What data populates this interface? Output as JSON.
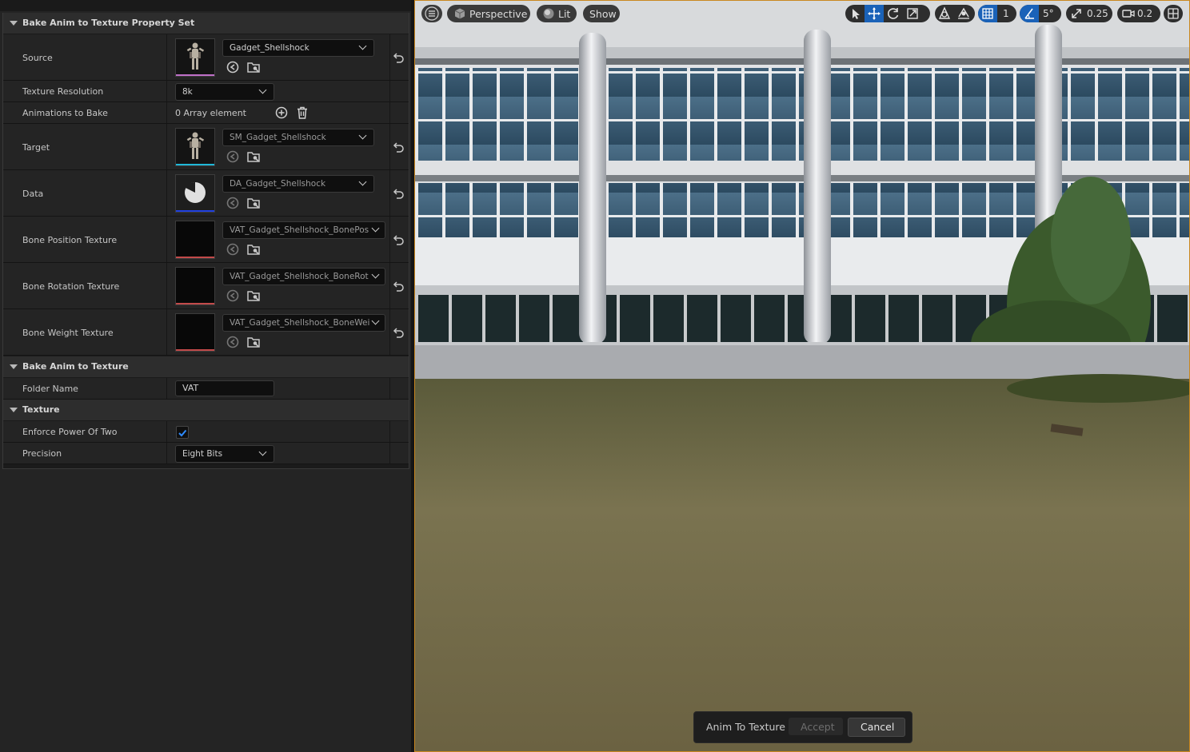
{
  "details": {
    "category1": "Bake Anim to Texture Property Set",
    "source": {
      "label": "Source",
      "value": "Gadget_Shellshock",
      "bar_color": "#c070c8"
    },
    "texture_resolution": {
      "label": "Texture Resolution",
      "value": "8k"
    },
    "animations": {
      "label": "Animations to Bake",
      "value": "0 Array element"
    },
    "target": {
      "label": "Target",
      "value": "SM_Gadget_Shellshock",
      "bar_color": "#1fb8d8"
    },
    "data": {
      "label": "Data",
      "value": "DA_Gadget_Shellshock",
      "bar_color": "#2040e0"
    },
    "bone_position": {
      "label": "Bone Position Texture",
      "value": "VAT_Gadget_Shellshock_BonePos",
      "bar_color": "#c24a4a"
    },
    "bone_rotation": {
      "label": "Bone Rotation Texture",
      "value": "VAT_Gadget_Shellshock_BoneRot",
      "bar_color": "#c24a4a"
    },
    "bone_weight": {
      "label": "Bone Weight Texture",
      "value": "VAT_Gadget_Shellshock_BoneWei",
      "bar_color": "#c24a4a"
    },
    "category2": "Bake Anim to Texture",
    "folder_name": {
      "label": "Folder Name",
      "value": "VAT"
    },
    "category3": "Texture",
    "enforce_pow2": {
      "label": "Enforce Power Of Two",
      "checked": true
    },
    "precision": {
      "label": "Precision",
      "value": "Eight Bits"
    }
  },
  "viewport": {
    "toolbar": {
      "perspective": "Perspective",
      "lit": "Lit",
      "show": "Show",
      "grid_snap": "1",
      "angle_snap": "5°",
      "scale_snap": "0.25",
      "camera_speed": "0.2"
    },
    "icons": [
      "menu-icon",
      "cube-icon",
      "lit-sphere-icon",
      "select-arrow-icon",
      "translate-icon",
      "rotate-icon",
      "scale-icon",
      "world-local-icon",
      "surface-snap-icon",
      "grid-icon",
      "angle-icon",
      "scale-snap-icon",
      "camera-icon",
      "layout-icon"
    ],
    "popup": {
      "title": "Anim To Texture",
      "accept": "Accept",
      "cancel": "Cancel"
    },
    "colors": {
      "accent": "#1a62b8",
      "border": "#c9871f"
    }
  }
}
